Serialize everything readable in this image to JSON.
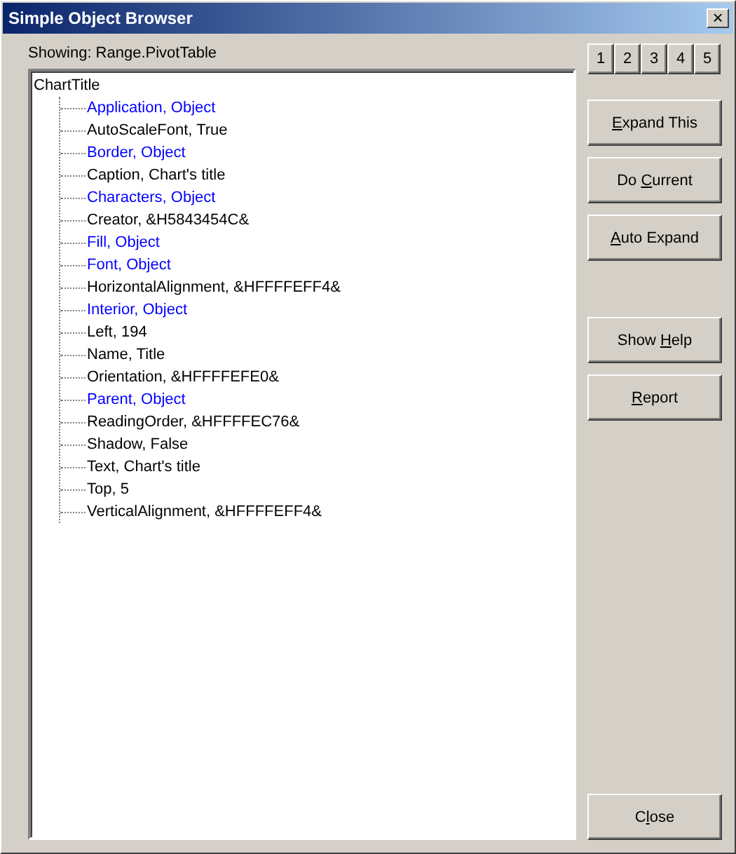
{
  "window": {
    "title": "Simple Object Browser",
    "close": "×"
  },
  "showing": "Showing: Range.PivotTable",
  "tree": {
    "label": "ChartTitle",
    "children": [
      {
        "label": "Application, Object",
        "kind": "object"
      },
      {
        "label": "AutoScaleFont, True",
        "kind": "value"
      },
      {
        "label": "Border, Object",
        "kind": "object"
      },
      {
        "label": "Caption, Chart's title",
        "kind": "value"
      },
      {
        "label": "Characters, Object",
        "kind": "object"
      },
      {
        "label": "Creator, &H5843454C&",
        "kind": "value"
      },
      {
        "label": "Fill, Object",
        "kind": "object"
      },
      {
        "label": "Font, Object",
        "kind": "object"
      },
      {
        "label": "HorizontalAlignment, &HFFFFEFF4&",
        "kind": "value"
      },
      {
        "label": "Interior, Object",
        "kind": "object"
      },
      {
        "label": "Left, 194",
        "kind": "value"
      },
      {
        "label": "Name, Title",
        "kind": "value"
      },
      {
        "label": "Orientation, &HFFFFEFE0&",
        "kind": "value"
      },
      {
        "label": "Parent, Object",
        "kind": "object"
      },
      {
        "label": "ReadingOrder, &HFFFFEC76&",
        "kind": "value"
      },
      {
        "label": "Shadow, False",
        "kind": "value"
      },
      {
        "label": "Text, Chart's title",
        "kind": "value"
      },
      {
        "label": "Top, 5",
        "kind": "value"
      },
      {
        "label": "VerticalAlignment, &HFFFFEFF4&",
        "kind": "value"
      }
    ]
  },
  "level_buttons": [
    "1",
    "2",
    "3",
    "4",
    "5"
  ],
  "button_groups": [
    [
      {
        "key": "E",
        "after": "xpand This"
      },
      {
        "before": "Do ",
        "key": "C",
        "after": "urrent"
      },
      {
        "key": "A",
        "after": "uto Expand"
      }
    ],
    [
      {
        "before": "Show ",
        "key": "H",
        "after": "elp"
      },
      {
        "key": "R",
        "after": "eport"
      }
    ]
  ],
  "close_button": {
    "before": "C",
    "key": "l",
    "after": "ose"
  }
}
